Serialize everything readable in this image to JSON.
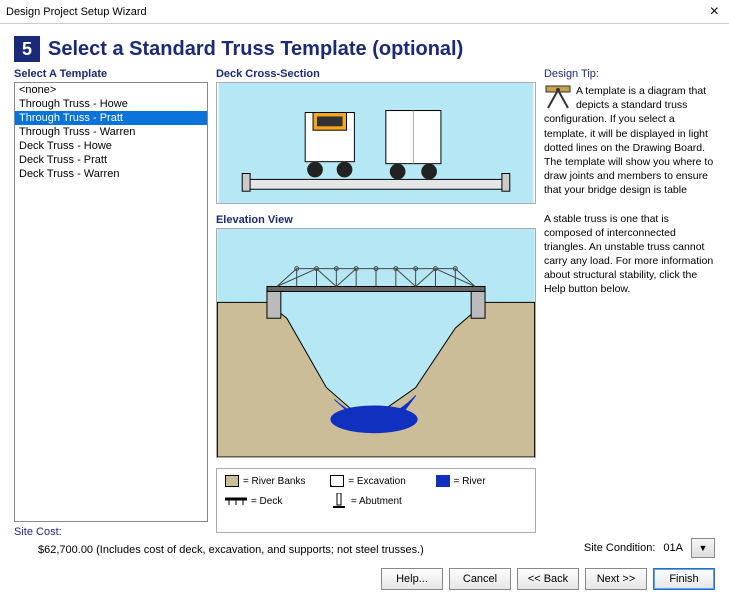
{
  "window": {
    "title": "Design Project Setup Wizard"
  },
  "step": {
    "number": "5",
    "title": "Select a Standard Truss Template (optional)"
  },
  "template_section": {
    "label": "Select A Template",
    "items": [
      "<none>",
      "Through Truss - Howe",
      "Through Truss - Pratt",
      "Through Truss - Warren",
      "Deck Truss - Howe",
      "Deck Truss - Pratt",
      "Deck Truss - Warren"
    ],
    "selected_index": 2
  },
  "deck_section": {
    "label": "Deck Cross-Section"
  },
  "elevation_section": {
    "label": "Elevation View"
  },
  "legend": {
    "river_banks": "= River Banks",
    "excavation": "= Excavation",
    "river": "= River",
    "deck": "= Deck",
    "abutment": "= Abutment"
  },
  "tip": {
    "label": "Design Tip:",
    "p1": "A template is a diagram that depicts a standard truss configuration. If you select a template, it will be displayed in light dotted lines on the Drawing Board. The template will show you where to draw joints and members to ensure that your bridge design is table",
    "p2": "A stable truss is one that is composed of interconnected triangles. An unstable truss cannot carry any load. For more information about structural stability, click the Help button below."
  },
  "site_cost": {
    "label": "Site Cost:",
    "value": "$62,700.00  (Includes cost of deck, excavation, and supports; not steel trusses.)"
  },
  "site_condition": {
    "label": "Site Condition:",
    "value": "01A"
  },
  "buttons": {
    "help": "Help...",
    "cancel": "Cancel",
    "back": "<< Back",
    "next": "Next >>",
    "finish": "Finish"
  }
}
